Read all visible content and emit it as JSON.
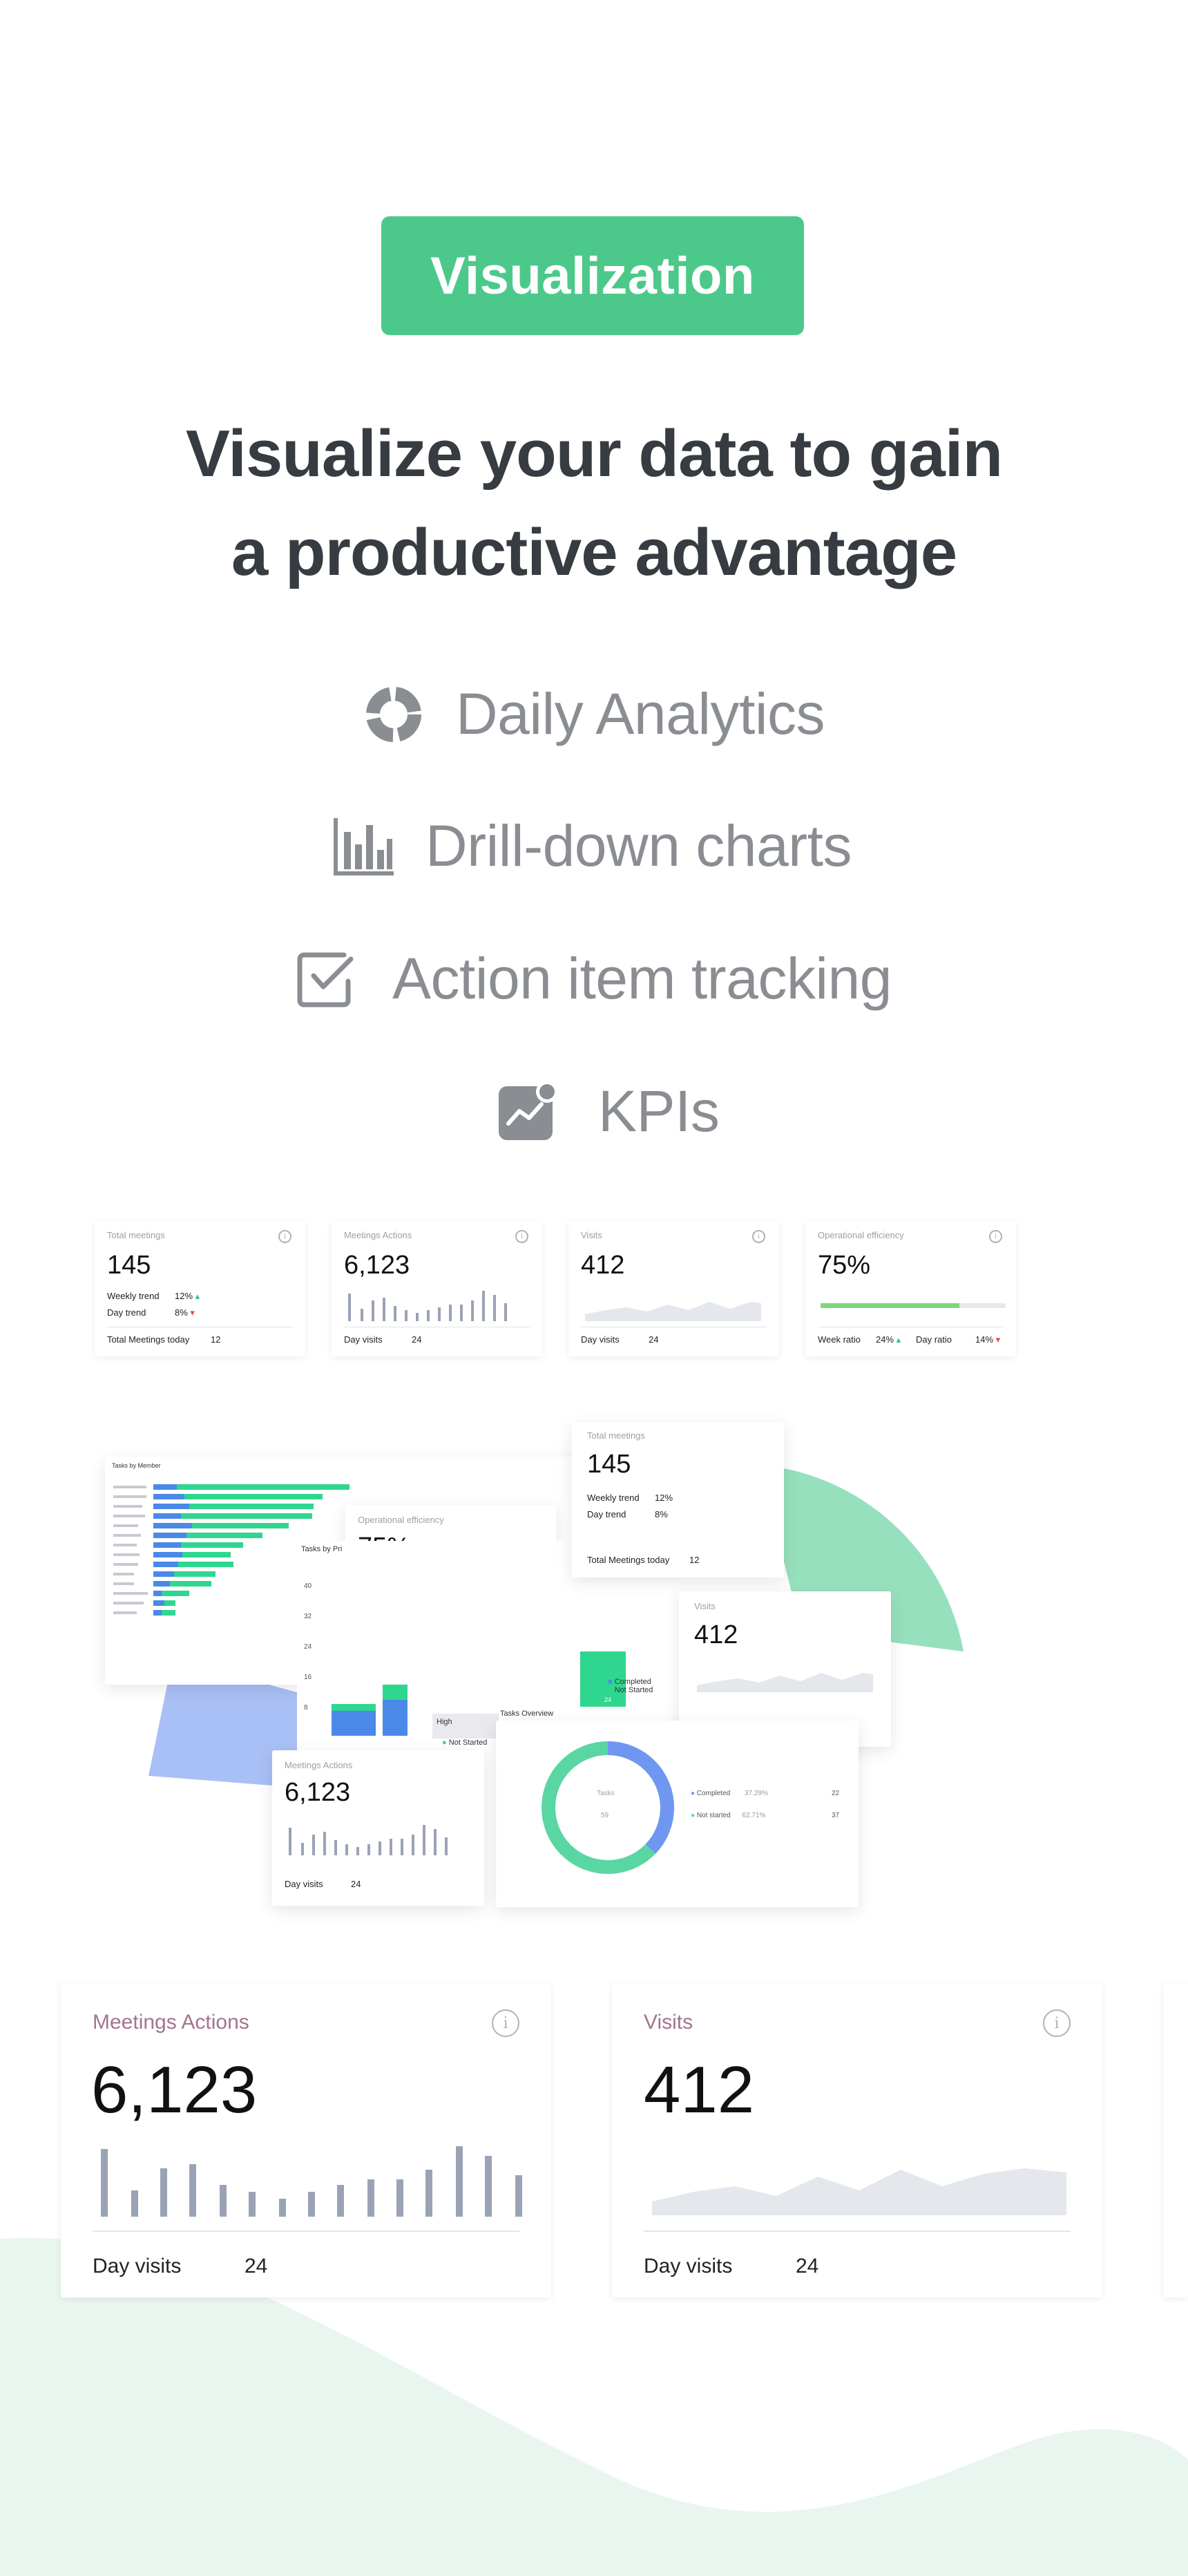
{
  "hero": {
    "badge": "Visualization",
    "headline_line1": "Visualize your data to gain",
    "headline_line2": "a productive advantage"
  },
  "features": [
    {
      "label": "Daily Analytics",
      "icon": "donut-chart-icon"
    },
    {
      "label": "Drill-down charts",
      "icon": "bar-chart-icon"
    },
    {
      "label": "Action item tracking",
      "icon": "checkbox-icon"
    },
    {
      "label": "KPIs",
      "icon": "trend-notification-icon"
    }
  ],
  "kpi_row": {
    "total_meetings": {
      "title": "Total meetings",
      "value": "145",
      "weekly_label": "Weekly trend",
      "weekly_value": "12%",
      "day_label": "Day trend",
      "day_value": "8%",
      "footer_label": "Total Meetings today",
      "footer_value": "12"
    },
    "meetings_actions": {
      "title": "Meetings Actions",
      "value": "6,123",
      "footer_label": "Day visits",
      "footer_value": "24"
    },
    "visits": {
      "title": "Visits",
      "value": "412",
      "footer_label": "Day visits",
      "footer_value": "24"
    },
    "operational": {
      "title": "Operational efficiency",
      "value": "75%",
      "progress": 0.75,
      "week_label": "Week ratio",
      "week_value": "24%",
      "day_label": "Day ratio",
      "day_value": "14%"
    }
  },
  "collage": {
    "tasks_by_member_title": "Tasks by Member",
    "tasks_by_priority_title": "Tasks by Pri",
    "tasks_overview_title": "Tasks Overview",
    "legend_completed": "Completed",
    "legend_not_started": "Not Started",
    "priority_high": "High",
    "not_started_label": "Not Started",
    "bar_value": "24",
    "donut_center_label": "Tasks",
    "donut_center_value": "59",
    "donut_rows": [
      {
        "label": "Completed",
        "pct": "37.29%",
        "count": "22"
      },
      {
        "label": "Not started",
        "pct": "62.71%",
        "count": "37"
      }
    ],
    "y_ticks": [
      "40",
      "32",
      "24",
      "16",
      "8"
    ]
  },
  "bottom_cards": {
    "meetings_actions": {
      "title": "Meetings Actions",
      "value": "6,123",
      "footer_label": "Day visits",
      "footer_value": "24"
    },
    "visits": {
      "title": "Visits",
      "value": "412",
      "footer_label": "Day visits",
      "footer_value": "24"
    }
  },
  "colors": {
    "brand_green": "#4cc98a",
    "accent_blue": "#6f97f2",
    "bar_gray": "#9aa3b5"
  }
}
